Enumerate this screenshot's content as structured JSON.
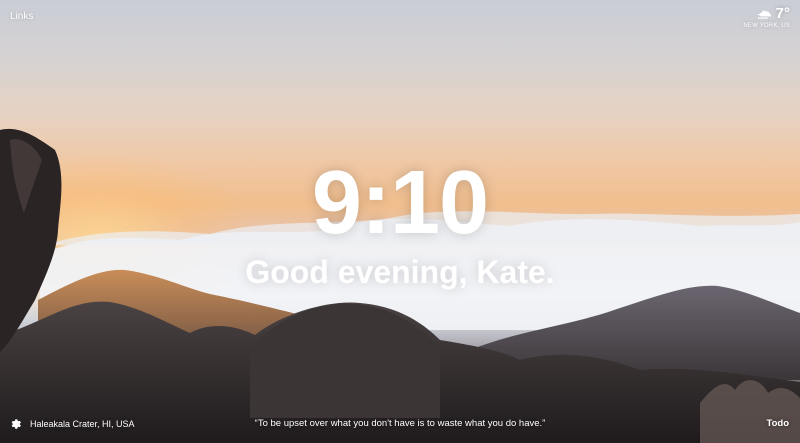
{
  "header": {
    "links_label": "Links"
  },
  "weather": {
    "icon": "wind-cloud-icon",
    "temperature": "7°",
    "location": "NEW YORK, US"
  },
  "main": {
    "time": "9:10",
    "greeting": "Good evening, Kate."
  },
  "footer": {
    "settings_icon": "gear-icon",
    "photo_location": "Haleakala Crater, HI, USA",
    "quote": "“To be upset over what you don't have is to waste what you do have.”",
    "todo_label": "Todo"
  }
}
